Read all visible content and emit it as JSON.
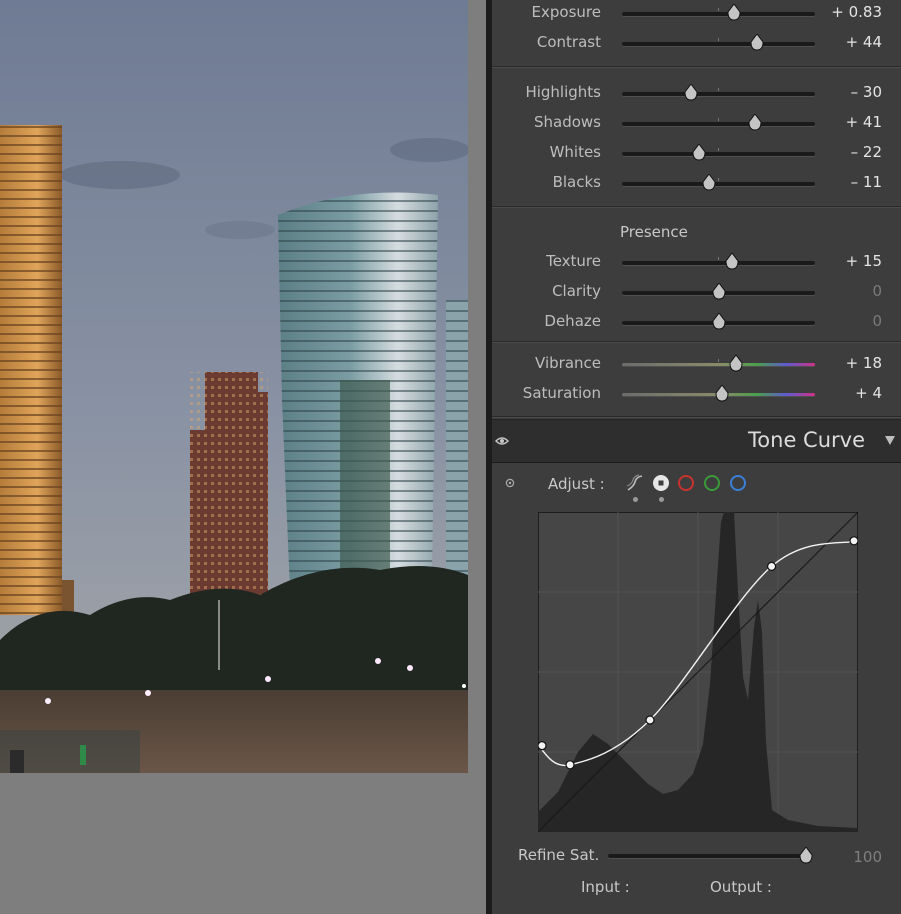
{
  "basic": {
    "sliders": [
      {
        "label": "Exposure",
        "value": "+ 0.83",
        "pos": 0.58,
        "zero": false
      },
      {
        "label": "Contrast",
        "value": "+ 44",
        "pos": 0.7,
        "zero": false
      },
      {
        "label": "Highlights",
        "value": "– 30",
        "pos": 0.36,
        "zero": false
      },
      {
        "label": "Shadows",
        "value": "+ 41",
        "pos": 0.69,
        "zero": false
      },
      {
        "label": "Whites",
        "value": "– 22",
        "pos": 0.4,
        "zero": false
      },
      {
        "label": "Blacks",
        "value": "– 11",
        "pos": 0.45,
        "zero": false
      },
      {
        "label": "Texture",
        "value": "+ 15",
        "pos": 0.57,
        "zero": false
      },
      {
        "label": "Clarity",
        "value": "0",
        "pos": 0.5,
        "zero": true
      },
      {
        "label": "Dehaze",
        "value": "0",
        "pos": 0.5,
        "zero": true
      },
      {
        "label": "Vibrance",
        "value": "+ 18",
        "pos": 0.59,
        "zero": false
      },
      {
        "label": "Saturation",
        "value": "+ 4",
        "pos": 0.52,
        "zero": false
      }
    ],
    "presence_label": "Presence"
  },
  "tone_curve": {
    "title": "Tone Curve",
    "adjust_label": "Adjust :",
    "channels": [
      "parametric",
      "point",
      "red",
      "green",
      "blue"
    ],
    "channel_colors": {
      "red": "#c8322f",
      "green": "#3a9a3a",
      "blue": "#3a7fd8"
    },
    "refine_label": "Refine Sat.",
    "refine_value": "100",
    "refine_pos": 1.0,
    "input_label": "Input :",
    "output_label": "Output :",
    "points": [
      [
        0,
        0.27
      ],
      [
        0.1,
        0.21
      ],
      [
        0.35,
        0.35
      ],
      [
        0.73,
        0.83
      ],
      [
        1,
        0.91
      ]
    ]
  }
}
